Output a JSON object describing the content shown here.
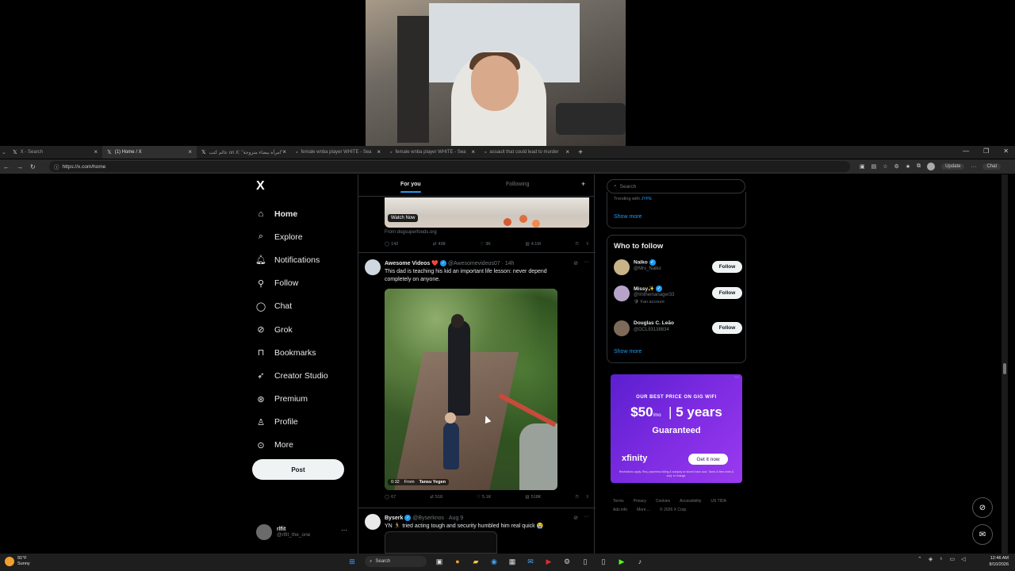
{
  "browser": {
    "tabs": [
      {
        "label": "X - Search",
        "active": false
      },
      {
        "label": "(1) Home / X",
        "active": true
      },
      {
        "label": "عالم كتب on X: \"امرأة بيضاء متزوجة\"",
        "active": false
      },
      {
        "label": "female wnba player WHITE - Sea",
        "active": false
      },
      {
        "label": "female wnba player WHITE - Sea",
        "active": false
      },
      {
        "label": "assault that could lead to murder",
        "active": false
      }
    ],
    "url": "https://x.com/home",
    "update_label": "Update",
    "chat_label": "Chat"
  },
  "sidebar": {
    "logo": "X",
    "items": [
      {
        "label": "Home",
        "icon": "home-icon"
      },
      {
        "label": "Explore",
        "icon": "search-icon"
      },
      {
        "label": "Notifications",
        "icon": "bell-icon"
      },
      {
        "label": "Follow",
        "icon": "add-person-icon"
      },
      {
        "label": "Chat",
        "icon": "chat-icon"
      },
      {
        "label": "Grok",
        "icon": "grok-icon"
      },
      {
        "label": "Bookmarks",
        "icon": "bookmark-icon"
      },
      {
        "label": "Creator Studio",
        "icon": "rocket-icon"
      },
      {
        "label": "Premium",
        "icon": "premium-icon"
      },
      {
        "label": "Profile",
        "icon": "person-icon"
      },
      {
        "label": "More",
        "icon": "more-circle-icon"
      }
    ],
    "post_label": "Post",
    "account": {
      "name": "rlfit",
      "handle": "@rlfit_the_one"
    }
  },
  "feed": {
    "tabs": [
      "For you",
      "Following"
    ],
    "promo": {
      "watch_now": "Watch Now",
      "from": "From dogsuperfoods.org",
      "stats": {
        "replies": "142",
        "reposts": "498",
        "likes": "3K",
        "views": "4.1M"
      }
    },
    "tweets": [
      {
        "name": "Awesome Videos",
        "emoji": "❤️",
        "handle": "@Awesomevideos07 · 14h",
        "text": "This dad is teaching his kid an important life lesson: never depend completely on anyone.",
        "video_time": "0:32",
        "video_from": "From",
        "video_author": "Tansu Yegen",
        "stats": {
          "replies": "67",
          "reposts": "518",
          "likes": "5.1K",
          "views": "518K"
        }
      },
      {
        "name": "Byserk",
        "handle": "@Byserknos · Aug 9",
        "text": "YN 🏃 tried acting tough and security humbled him real quick 😭"
      }
    ]
  },
  "right": {
    "search_placeholder": "Search",
    "trending_prefix": "Trending with",
    "trending_tag": "JYPE",
    "show_more": "Show more",
    "who_to_follow": "Who to follow",
    "suggestions": [
      {
        "name": "Naiko",
        "handle": "@Mrs_Naiko",
        "extra": "",
        "color": "#c9b48a"
      },
      {
        "name": "Missy✨",
        "handle": "@Imthemanager33",
        "extra": "🛡 Fan account",
        "color": "#b7a3c8"
      },
      {
        "name": "Douglas C. Leão",
        "handle": "@DCL93138834",
        "extra": "",
        "color": "#7d6a58"
      }
    ],
    "follow_label": "Follow",
    "ad": {
      "headline": "OUR BEST PRICE ON GIG WIFI",
      "price": "$50",
      "per": "/mo",
      "term": "5 years",
      "guaranteed": "Guaranteed",
      "brand": "xfinity",
      "cta": "Get it now",
      "fine_print": "Restrictions apply. Req. paperless billing & autopay w/ stored bank acct. Taxes & fees extra & subj. to change."
    },
    "footer": [
      "Terms",
      "Privacy",
      "Cookies",
      "Accessibility",
      "US TIDA",
      "Ads info",
      "More ...",
      "© 2026 X Corp."
    ]
  },
  "taskbar": {
    "weather_temp": "91°F",
    "weather_cond": "Sunny",
    "search_label": "Search",
    "time": "12:46 AM",
    "date": "8/10/2026"
  },
  "colors": {
    "accent": "#1d9bf0",
    "background": "#000000",
    "ad_purple": "#6d26d9"
  }
}
